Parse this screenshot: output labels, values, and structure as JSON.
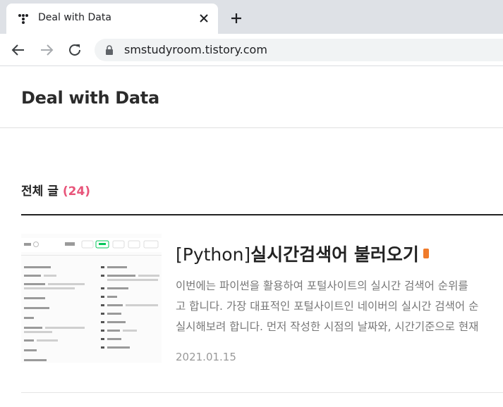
{
  "browser": {
    "tab_title": "Deal with Data",
    "url": "smstudyroom.tistory.com"
  },
  "site": {
    "title": "Deal with Data"
  },
  "section": {
    "heading": "전체 글",
    "count": "(24)"
  },
  "post": {
    "title_prefix": "[Python]",
    "title_main": "실시간검색어 불러오기",
    "excerpt_lines": [
      "이번에는 파이썬을 활용하여 포털사이트의 실시간 검색어 순위를",
      "고 합니다. 가장 대표적인 포털사이트인 네이버의 실시간 검색어 순",
      "실시해보려 합니다. 먼저 작성한 시점의 날짜와, 시간기준으로 현재"
    ],
    "date": "2021.01.15"
  },
  "colors": {
    "accent": "#e8557a",
    "badge": "#f07b2b",
    "naver_green": "#03c75a"
  }
}
